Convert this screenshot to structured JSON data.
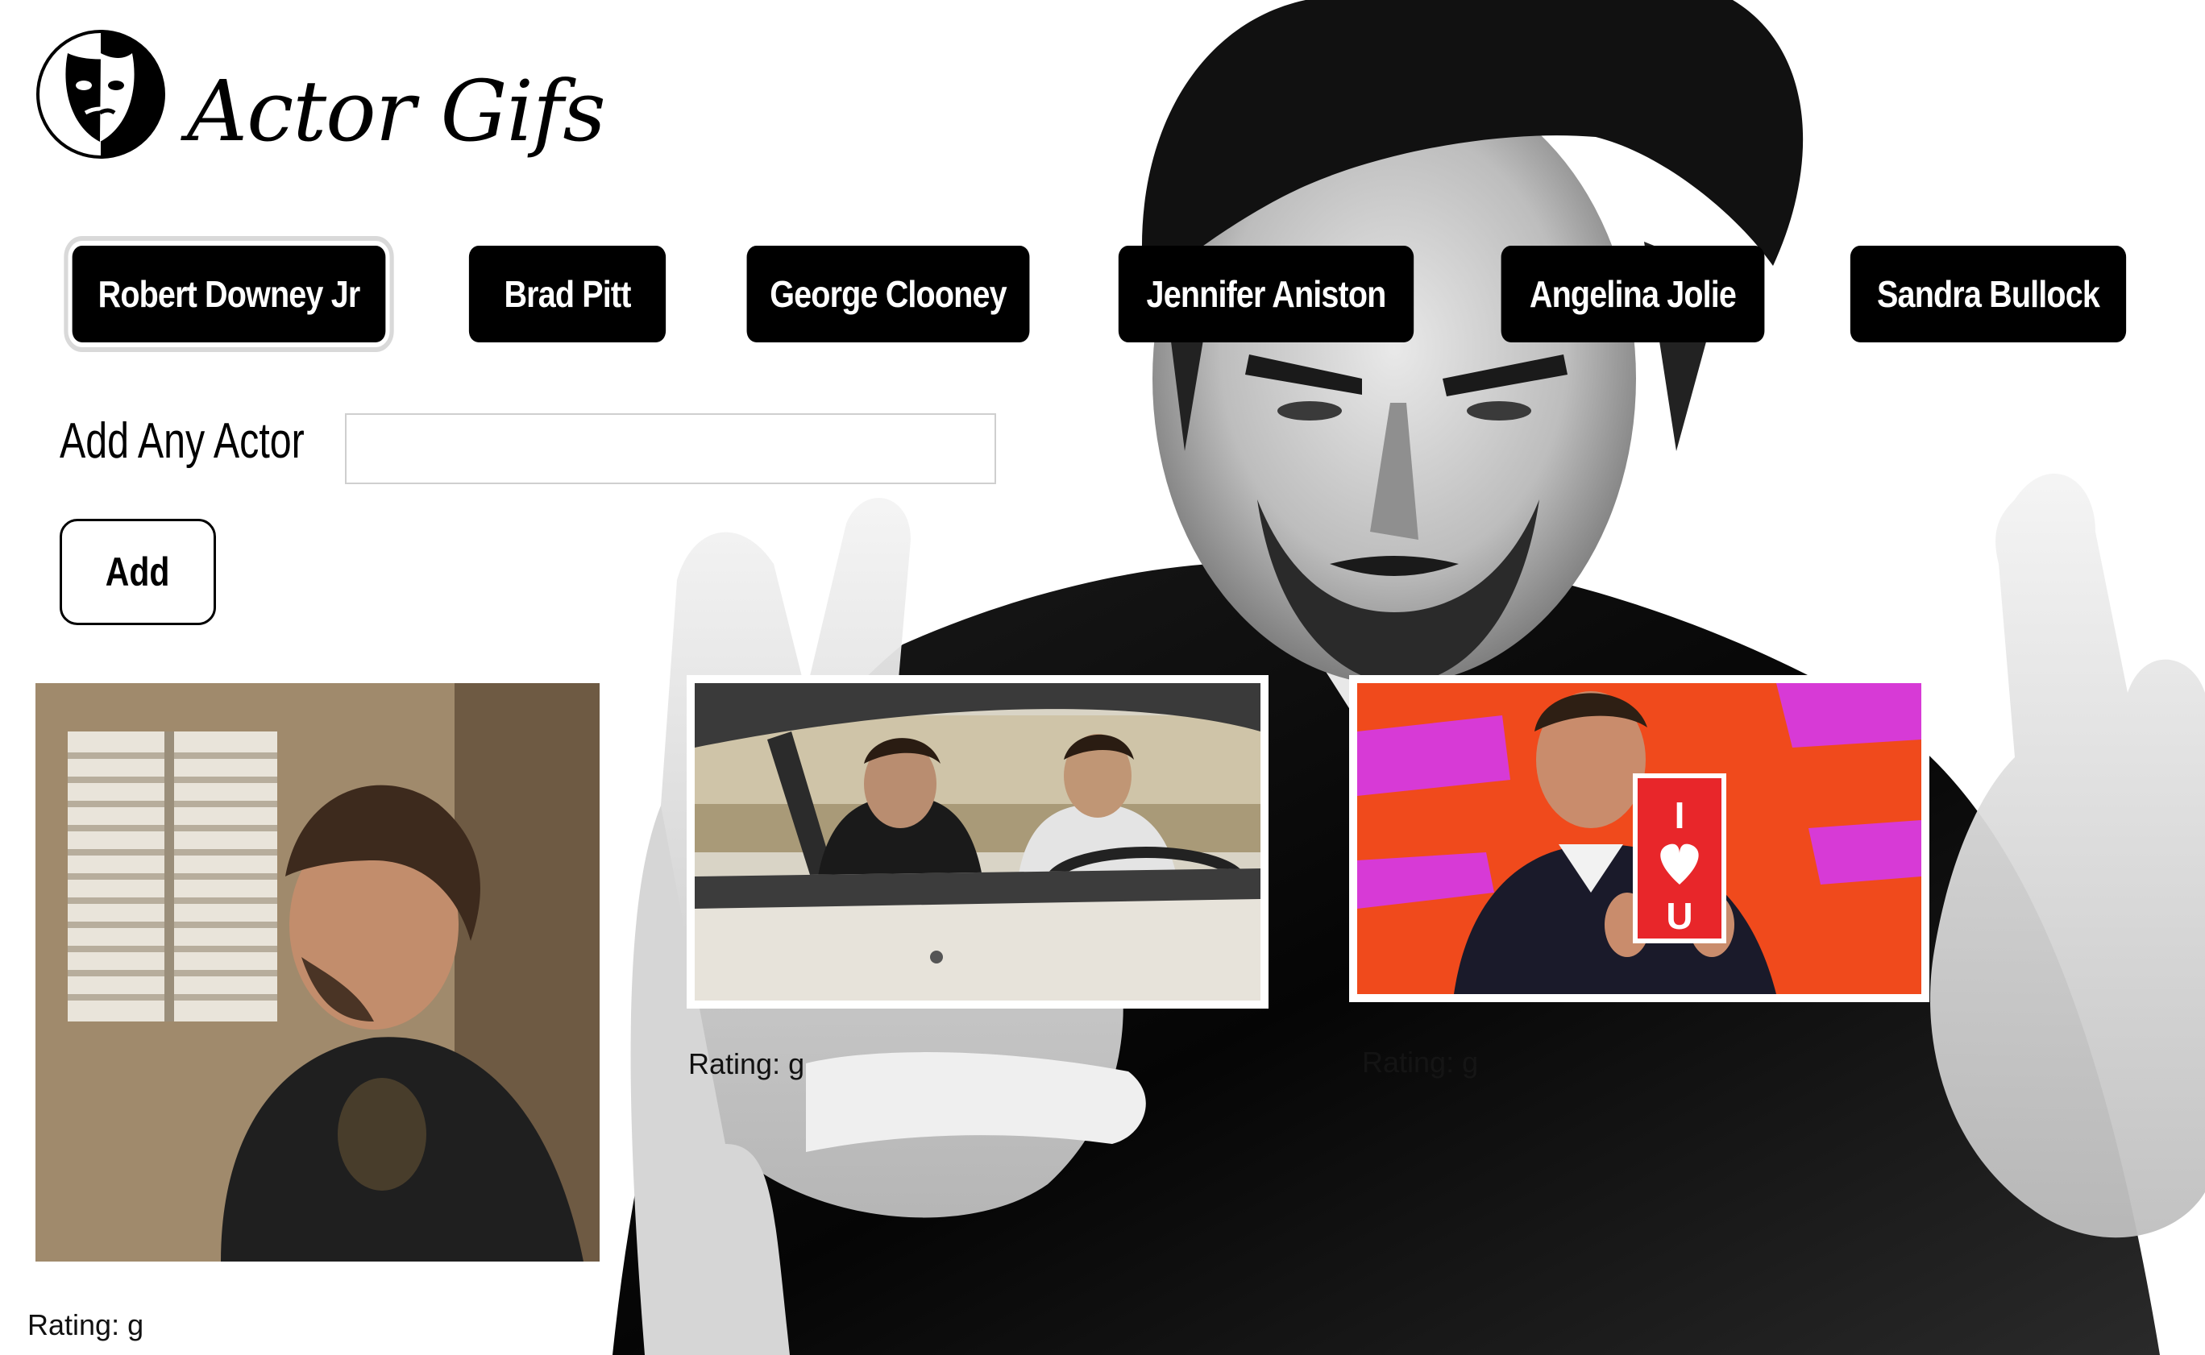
{
  "app": {
    "title": "Actor Gifs"
  },
  "actors": [
    {
      "label": "Robert Downey Jr",
      "active": true
    },
    {
      "label": "Brad Pitt",
      "active": false
    },
    {
      "label": "George Clooney",
      "active": false
    },
    {
      "label": "Jennifer Aniston",
      "active": false
    },
    {
      "label": "Angelina Jolie",
      "active": false
    },
    {
      "label": "Sandra Bullock",
      "active": false
    }
  ],
  "add_form": {
    "label": "Add Any Actor",
    "input_value": "",
    "input_placeholder": "",
    "button_label": "Add"
  },
  "gifs": [
    {
      "rating": "Rating: g",
      "icon": "gif-image-man-in-room"
    },
    {
      "rating": "Rating: g",
      "icon": "gif-image-two-men-in-car"
    },
    {
      "rating": "Rating: g",
      "icon": "gif-image-man-holding-love-card",
      "card_text_top": "I",
      "card_text_bottom": "U"
    }
  ],
  "colors": {
    "button_bg": "#000000",
    "button_text": "#ffffff",
    "card_red": "#e8262a",
    "gif3_bg": "#f04a1c"
  }
}
